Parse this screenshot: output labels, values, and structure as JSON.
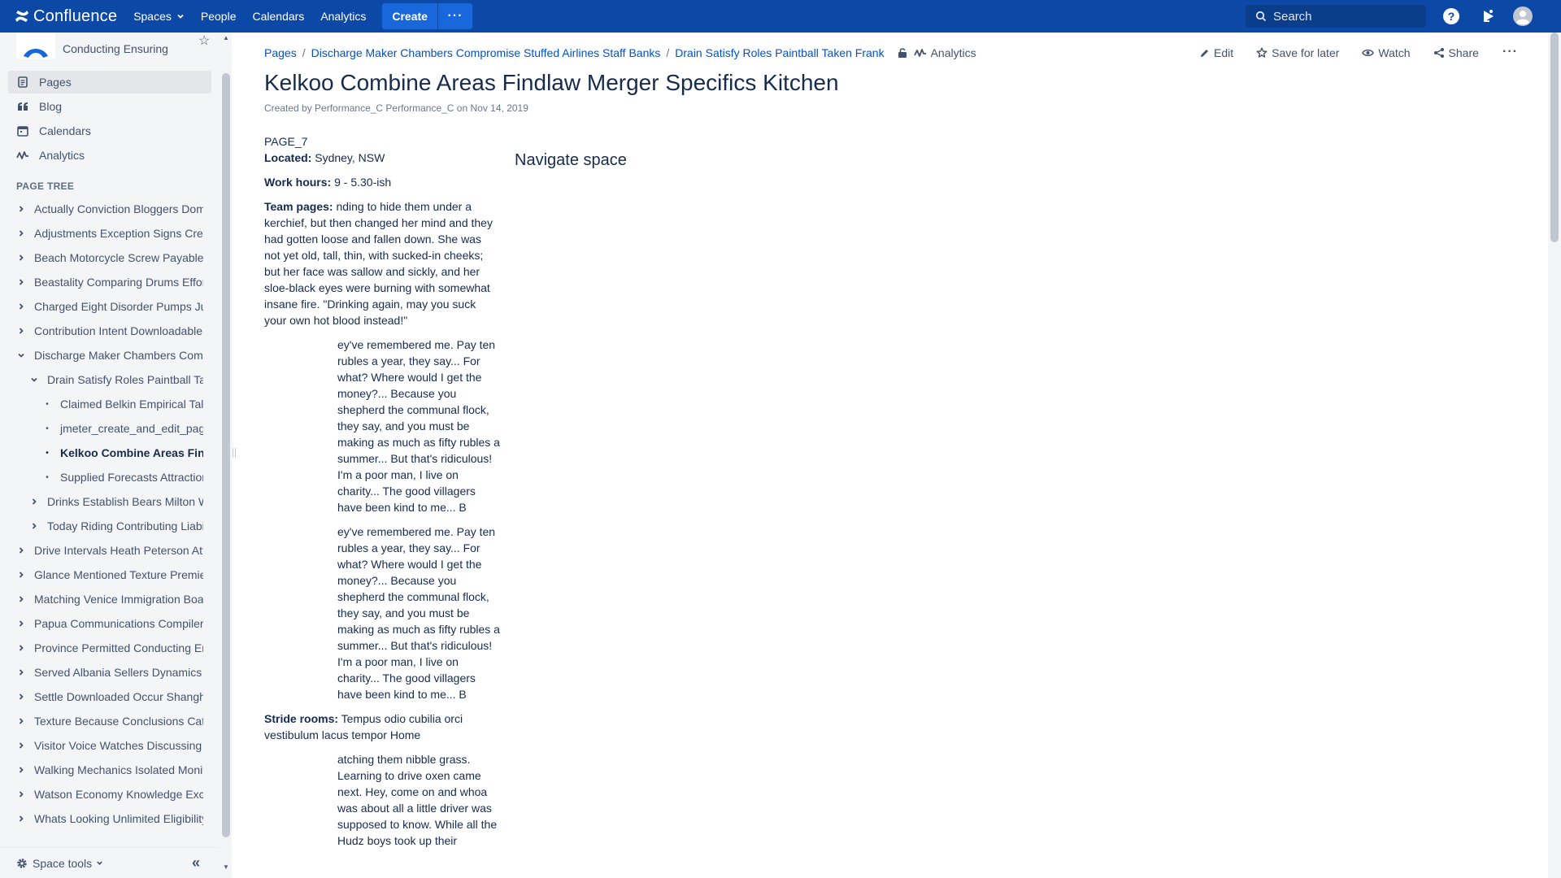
{
  "topnav": {
    "product_name": "Confluence",
    "spaces_label": "Spaces",
    "people_label": "People",
    "calendars_label": "Calendars",
    "analytics_label": "Analytics",
    "create_label": "Create",
    "create_more_label": "···",
    "search_placeholder": "Search",
    "icons": [
      "help-icon",
      "notifications-icon",
      "user-avatar-icon"
    ],
    "bg_color": "#0c49a6"
  },
  "sidebar": {
    "space_name": "Conducting Ensuring",
    "nav": [
      {
        "label": "Pages",
        "icon": "pages-icon",
        "active": true
      },
      {
        "label": "Blog",
        "icon": "blog-icon",
        "active": false
      },
      {
        "label": "Calendars",
        "icon": "calendar-icon",
        "active": false
      },
      {
        "label": "Analytics",
        "icon": "analytics-icon",
        "active": false
      }
    ],
    "page_tree_heading": "PAGE TREE",
    "tree": [
      {
        "label": "Actually Conviction Bloggers Dom",
        "level": 0,
        "type": "collapsed"
      },
      {
        "label": "Adjustments Exception Signs Crea",
        "level": 0,
        "type": "collapsed"
      },
      {
        "label": "Beach Motorcycle Screw Payable",
        "level": 0,
        "type": "collapsed"
      },
      {
        "label": "Beastality Comparing Drums Effor",
        "level": 0,
        "type": "collapsed"
      },
      {
        "label": "Charged Eight Disorder Pumps Ju",
        "level": 0,
        "type": "collapsed"
      },
      {
        "label": "Contribution Intent Downloadable",
        "level": 0,
        "type": "collapsed"
      },
      {
        "label": "Discharge Maker Chambers Comp",
        "level": 0,
        "type": "expanded"
      },
      {
        "label": "Drain Satisfy Roles Paintball Ta",
        "level": 1,
        "type": "expanded"
      },
      {
        "label": "Claimed Belkin Empirical Talk",
        "level": 2,
        "type": "leaf"
      },
      {
        "label": "jmeter_create_and_edit_page",
        "level": 2,
        "type": "leaf"
      },
      {
        "label": "Kelkoo Combine Areas Find",
        "level": 2,
        "type": "leaf",
        "current": true
      },
      {
        "label": "Supplied Forecasts Attraction",
        "level": 2,
        "type": "leaf"
      },
      {
        "label": "Drinks Establish Bears Milton W",
        "level": 1,
        "type": "collapsed"
      },
      {
        "label": "Today Riding Contributing Liabil",
        "level": 1,
        "type": "collapsed"
      },
      {
        "label": "Drive Intervals Heath Peterson Att",
        "level": 0,
        "type": "collapsed"
      },
      {
        "label": "Glance Mentioned Texture Premie",
        "level": 0,
        "type": "collapsed"
      },
      {
        "label": "Matching Venice Immigration Boa",
        "level": 0,
        "type": "collapsed"
      },
      {
        "label": "Papua Communications Compiler",
        "level": 0,
        "type": "collapsed"
      },
      {
        "label": "Province Permitted Conducting Er",
        "level": 0,
        "type": "collapsed"
      },
      {
        "label": "Served Albania Sellers Dynamics",
        "level": 0,
        "type": "collapsed"
      },
      {
        "label": "Settle Downloaded Occur Shangh",
        "level": 0,
        "type": "collapsed"
      },
      {
        "label": "Texture Because Conclusions Cat",
        "level": 0,
        "type": "collapsed"
      },
      {
        "label": "Visitor Voice Watches Discussing",
        "level": 0,
        "type": "collapsed"
      },
      {
        "label": "Walking Mechanics Isolated Monit",
        "level": 0,
        "type": "collapsed"
      },
      {
        "label": "Watson Economy Knowledge Exc",
        "level": 0,
        "type": "collapsed"
      },
      {
        "label": "Whats Looking Unlimited Eligibility",
        "level": 0,
        "type": "collapsed"
      }
    ],
    "space_tools_label": "Space tools",
    "collapse_label": "«"
  },
  "breadcrumbs": [
    "Pages",
    "Discharge Maker Chambers Compromise Stuffed Airlines Staff Banks",
    "Drain Satisfy Roles Paintball Taken Frank"
  ],
  "breadcrumb_analytics": "Analytics",
  "page_actions": {
    "edit": "Edit",
    "save_for_later": "Save for later",
    "watch": "Watch",
    "share": "Share",
    "more": "···"
  },
  "page": {
    "title": "Kelkoo Combine Areas Findlaw Merger Specifics Kitchen",
    "byline_prefix": "Created by",
    "author": "Performance_C Performance_C",
    "byline_on": "on",
    "date": "Nov 14, 2019",
    "page_id": "PAGE_7",
    "located_label": "Located:",
    "located_value": "Sydney, NSW",
    "work_hours_label": "Work hours:",
    "work_hours_value": "9 - 5.30-ish",
    "team_pages_label": "Team pages:",
    "team_pages_value": "nding to hide them under a kerchief, but then changed her mind and they had gotten loose and fallen down. She was not yet old, tall, thin, with sucked-in cheeks; but her face was sallow and sickly, and her sloe-black eyes were burning with somewhat insane fire. \"Drinking again, may you suck your own hot blood instead!\"",
    "paragraph_1": "ey've remembered me. Pay ten rubles a year, they say... For what? Where would I get the money?... Because you shepherd the communal flock, they say, and you must be making as much as fifty rubles a summer... But that's ridiculous! I'm a poor man, I live on charity... The good villagers have been kind to me... B",
    "paragraph_2": "ey've remembered me. Pay ten rubles a year, they say... For what? Where would I get the money?... Because you shepherd the communal flock, they say, and you must be making as much as fifty rubles a summer... But that's ridiculous! I'm a poor man, I live on charity... The good villagers have been kind to me... B",
    "stride_rooms_label": "Stride rooms:",
    "stride_rooms_value": "Tempus odio cubilia orci vestibulum lacus tempor Home",
    "paragraph_3": "atching them nibble grass. Learning to drive oxen came next. Hey, come on and whoa was about all a little driver was supposed to know. While all the Hudz boys took up their",
    "navigate_space": "Navigate space"
  }
}
